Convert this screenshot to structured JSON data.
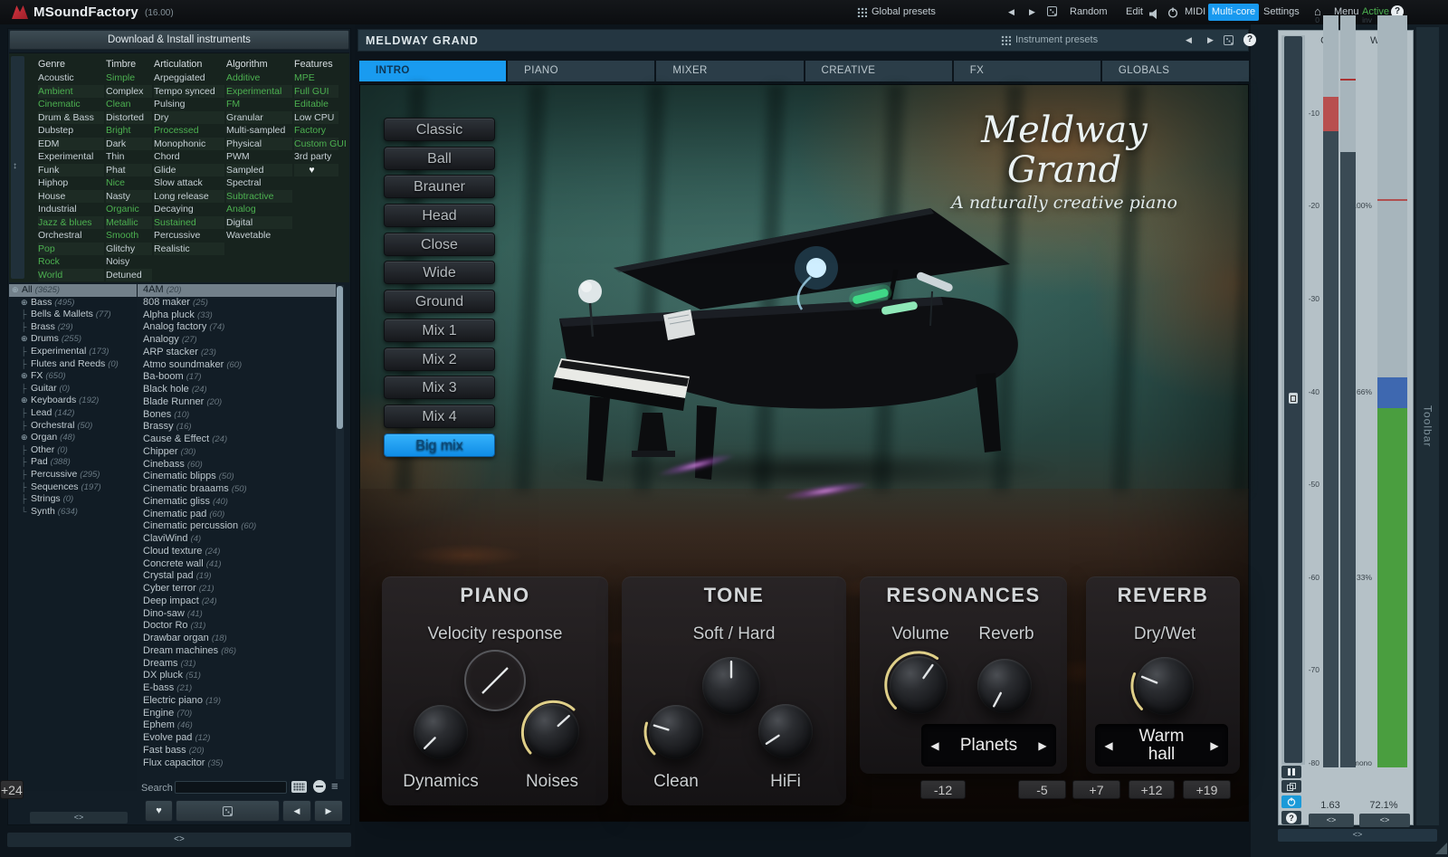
{
  "topbar": {
    "logo_text": "MSoundFactory",
    "version": "(16.00)",
    "global_presets": "Global presets",
    "random": "Random",
    "edit": "Edit",
    "midi": "MIDI",
    "multicore": "Multi-core",
    "settings": "Settings",
    "menu": "Menu",
    "active": "Active",
    "help": "?"
  },
  "browser": {
    "install_button": "Download & Install instruments",
    "search_label": "Search",
    "filters": {
      "genre": {
        "header": "Genre",
        "items": [
          {
            "label": "Acoustic",
            "state": "off"
          },
          {
            "label": "Ambient",
            "state": "on"
          },
          {
            "label": "Cinematic",
            "state": "on"
          },
          {
            "label": "Drum & Bass",
            "state": "off"
          },
          {
            "label": "Dubstep",
            "state": "off"
          },
          {
            "label": "EDM",
            "state": "off"
          },
          {
            "label": "Experimental",
            "state": "off"
          },
          {
            "label": "Funk",
            "state": "off"
          },
          {
            "label": "Hiphop",
            "state": "off"
          },
          {
            "label": "House",
            "state": "off"
          },
          {
            "label": "Industrial",
            "state": "off"
          },
          {
            "label": "Jazz & blues",
            "state": "on"
          },
          {
            "label": "Orchestral",
            "state": "off"
          },
          {
            "label": "Pop",
            "state": "on"
          },
          {
            "label": "Rock",
            "state": "on"
          },
          {
            "label": "World",
            "state": "on"
          }
        ]
      },
      "timbre": {
        "header": "Timbre",
        "items": [
          {
            "label": "Simple",
            "state": "on"
          },
          {
            "label": "Complex",
            "state": "off"
          },
          {
            "label": "Clean",
            "state": "on"
          },
          {
            "label": "Distorted",
            "state": "off"
          },
          {
            "label": "Bright",
            "state": "on"
          },
          {
            "label": "Dark",
            "state": "off"
          },
          {
            "label": "Thin",
            "state": "off"
          },
          {
            "label": "Phat",
            "state": "off"
          },
          {
            "label": "Nice",
            "state": "on"
          },
          {
            "label": "Nasty",
            "state": "off"
          },
          {
            "label": "Organic",
            "state": "on"
          },
          {
            "label": "Metallic",
            "state": "on"
          },
          {
            "label": "Smooth",
            "state": "on"
          },
          {
            "label": "Glitchy",
            "state": "off"
          },
          {
            "label": "Noisy",
            "state": "off"
          },
          {
            "label": "Detuned",
            "state": "off"
          }
        ]
      },
      "articulation": {
        "header": "Articulation",
        "items": [
          {
            "label": "Arpeggiated",
            "state": "off"
          },
          {
            "label": "Tempo synced",
            "state": "off"
          },
          {
            "label": "Pulsing",
            "state": "off"
          },
          {
            "label": "Dry",
            "state": "off"
          },
          {
            "label": "Processed",
            "state": "on"
          },
          {
            "label": "Monophonic",
            "state": "off"
          },
          {
            "label": "Chord",
            "state": "off"
          },
          {
            "label": "Glide",
            "state": "off"
          },
          {
            "label": "Slow attack",
            "state": "off"
          },
          {
            "label": "Long release",
            "state": "off"
          },
          {
            "label": "Decaying",
            "state": "off"
          },
          {
            "label": "Sustained",
            "state": "on"
          },
          {
            "label": "Percussive",
            "state": "off"
          },
          {
            "label": "Realistic",
            "state": "off"
          }
        ]
      },
      "algorithm": {
        "header": "Algorithm",
        "items": [
          {
            "label": "Additive",
            "state": "on"
          },
          {
            "label": "Experimental",
            "state": "on"
          },
          {
            "label": "FM",
            "state": "on"
          },
          {
            "label": "Granular",
            "state": "off"
          },
          {
            "label": "Multi-sampled",
            "state": "off"
          },
          {
            "label": "Physical",
            "state": "off"
          },
          {
            "label": "PWM",
            "state": "off"
          },
          {
            "label": "Sampled",
            "state": "off"
          },
          {
            "label": "Spectral",
            "state": "off"
          },
          {
            "label": "Subtractive",
            "state": "on"
          },
          {
            "label": "Analog",
            "state": "on"
          },
          {
            "label": "Digital",
            "state": "off"
          },
          {
            "label": "Wavetable",
            "state": "off"
          }
        ]
      },
      "features": {
        "header": "Features",
        "items": [
          {
            "label": "MPE",
            "state": "on"
          },
          {
            "label": "Full GUI",
            "state": "on"
          },
          {
            "label": "Editable",
            "state": "on"
          },
          {
            "label": "Low CPU",
            "state": "off"
          },
          {
            "label": "Factory",
            "state": "on"
          },
          {
            "label": "Custom GUI",
            "state": "on"
          },
          {
            "label": "3rd party",
            "state": "off"
          },
          {
            "label": "♥",
            "state": "fav"
          }
        ]
      }
    },
    "tree": {
      "items": [
        {
          "prefix": "expand",
          "label": "All",
          "count": "(3625)",
          "state": "selected",
          "indent": 0
        },
        {
          "prefix": "expand",
          "label": "Bass",
          "count": "(495)",
          "state": "off",
          "indent": 1
        },
        {
          "prefix": "tee",
          "label": "Bells & Mallets",
          "count": "(77)",
          "state": "off",
          "indent": 1
        },
        {
          "prefix": "tee",
          "label": "Brass",
          "count": "(29)",
          "state": "off",
          "indent": 1
        },
        {
          "prefix": "expand",
          "label": "Drums",
          "count": "(255)",
          "state": "off",
          "indent": 1
        },
        {
          "prefix": "tee",
          "label": "Experimental",
          "count": "(173)",
          "state": "off",
          "indent": 1
        },
        {
          "prefix": "tee",
          "label": "Flutes and Reeds",
          "count": "(0)",
          "state": "off",
          "indent": 1
        },
        {
          "prefix": "expand",
          "label": "FX",
          "count": "(650)",
          "state": "off",
          "indent": 1
        },
        {
          "prefix": "tee",
          "label": "Guitar",
          "count": "(0)",
          "state": "off",
          "indent": 1
        },
        {
          "prefix": "expand",
          "label": "Keyboards",
          "count": "(192)",
          "state": "off",
          "indent": 1
        },
        {
          "prefix": "tee",
          "label": "Lead",
          "count": "(142)",
          "state": "off",
          "indent": 1
        },
        {
          "prefix": "tee",
          "label": "Orchestral",
          "count": "(50)",
          "state": "off",
          "indent": 1
        },
        {
          "prefix": "expand",
          "label": "Organ",
          "count": "(48)",
          "state": "off",
          "indent": 1
        },
        {
          "prefix": "tee",
          "label": "Other",
          "count": "(0)",
          "state": "off",
          "indent": 1
        },
        {
          "prefix": "tee",
          "label": "Pad",
          "count": "(388)",
          "state": "off",
          "indent": 1
        },
        {
          "prefix": "tee",
          "label": "Percussive",
          "count": "(295)",
          "state": "off",
          "indent": 1
        },
        {
          "prefix": "tee",
          "label": "Sequences",
          "count": "(197)",
          "state": "off",
          "indent": 1
        },
        {
          "prefix": "tee",
          "label": "Strings",
          "count": "(0)",
          "state": "off",
          "indent": 1
        },
        {
          "prefix": "end",
          "label": "Synth",
          "count": "(634)",
          "state": "off",
          "indent": 1
        }
      ]
    },
    "instruments": {
      "items": [
        {
          "label": "4AM",
          "count": "(20)",
          "state": "selected"
        },
        {
          "label": "808 maker",
          "count": "(25)",
          "state": "off"
        },
        {
          "label": "Alpha pluck",
          "count": "(33)",
          "state": "off"
        },
        {
          "label": "Analog factory",
          "count": "(74)",
          "state": "off"
        },
        {
          "label": "Analogy",
          "count": "(27)",
          "state": "off"
        },
        {
          "label": "ARP stacker",
          "count": "(23)",
          "state": "off"
        },
        {
          "label": "Atmo soundmaker",
          "count": "(60)",
          "state": "off"
        },
        {
          "label": "Ba-boom",
          "count": "(17)",
          "state": "off"
        },
        {
          "label": "Black hole",
          "count": "(24)",
          "state": "off"
        },
        {
          "label": "Blade Runner",
          "count": "(20)",
          "state": "off"
        },
        {
          "label": "Bones",
          "count": "(10)",
          "state": "off"
        },
        {
          "label": "Brassy",
          "count": "(16)",
          "state": "off"
        },
        {
          "label": "Cause & Effect",
          "count": "(24)",
          "state": "off"
        },
        {
          "label": "Chipper",
          "count": "(30)",
          "state": "off"
        },
        {
          "label": "Cinebass",
          "count": "(60)",
          "state": "off"
        },
        {
          "label": "Cinematic blipps",
          "count": "(50)",
          "state": "off"
        },
        {
          "label": "Cinematic braaams",
          "count": "(50)",
          "state": "off"
        },
        {
          "label": "Cinematic gliss",
          "count": "(40)",
          "state": "off"
        },
        {
          "label": "Cinematic pad",
          "count": "(60)",
          "state": "off"
        },
        {
          "label": "Cinematic percussion",
          "count": "(60)",
          "state": "off"
        },
        {
          "label": "ClaviWind",
          "count": "(4)",
          "state": "off"
        },
        {
          "label": "Cloud texture",
          "count": "(24)",
          "state": "off"
        },
        {
          "label": "Concrete wall",
          "count": "(41)",
          "state": "off"
        },
        {
          "label": "Crystal pad",
          "count": "(19)",
          "state": "off"
        },
        {
          "label": "Cyber terror",
          "count": "(21)",
          "state": "off"
        },
        {
          "label": "Deep impact",
          "count": "(24)",
          "state": "off"
        },
        {
          "label": "Dino-saw",
          "count": "(41)",
          "state": "off"
        },
        {
          "label": "Doctor Ro",
          "count": "(31)",
          "state": "off"
        },
        {
          "label": "Drawbar organ",
          "count": "(18)",
          "state": "off"
        },
        {
          "label": "Dream machines",
          "count": "(86)",
          "state": "off"
        },
        {
          "label": "Dreams",
          "count": "(31)",
          "state": "off"
        },
        {
          "label": "DX pluck",
          "count": "(51)",
          "state": "off"
        },
        {
          "label": "E-bass",
          "count": "(21)",
          "state": "off"
        },
        {
          "label": "Electric piano",
          "count": "(19)",
          "state": "off"
        },
        {
          "label": "Engine",
          "count": "(70)",
          "state": "off"
        },
        {
          "label": "Ephem",
          "count": "(46)",
          "state": "off"
        },
        {
          "label": "Evolve pad",
          "count": "(12)",
          "state": "off"
        },
        {
          "label": "Fast bass",
          "count": "(20)",
          "state": "off"
        },
        {
          "label": "Flux capacitor",
          "count": "(35)",
          "state": "off"
        }
      ]
    }
  },
  "instrument": {
    "title": "MELDWAY GRAND",
    "presets_label": "Instrument presets",
    "tabs": [
      {
        "label": "INTRO",
        "state": "on"
      },
      {
        "label": "PIANO",
        "state": "off"
      },
      {
        "label": "MIXER",
        "state": "off"
      },
      {
        "label": "CREATIVE",
        "state": "off"
      },
      {
        "label": "FX",
        "state": "off"
      },
      {
        "label": "GLOBALS",
        "state": "off"
      }
    ],
    "hero": {
      "title": "Meldway Grand",
      "subtitle": "A naturally creative piano"
    },
    "mic_buttons": [
      {
        "label": "Classic",
        "state": "off"
      },
      {
        "label": "Ball",
        "state": "off"
      },
      {
        "label": "Brauner",
        "state": "off"
      },
      {
        "label": "Head",
        "state": "off"
      },
      {
        "label": "Close",
        "state": "off"
      },
      {
        "label": "Wide",
        "state": "off"
      },
      {
        "label": "Ground",
        "state": "off"
      },
      {
        "label": "Mix 1",
        "state": "off"
      },
      {
        "label": "Mix 2",
        "state": "off"
      },
      {
        "label": "Mix 3",
        "state": "off"
      },
      {
        "label": "Mix 4",
        "state": "off"
      },
      {
        "label": "Big mix",
        "state": "on"
      }
    ],
    "panels": {
      "piano": {
        "title": "PIANO",
        "control": "Velocity response",
        "knob1": "Dynamics",
        "knob2": "Noises"
      },
      "tone": {
        "title": "TONE",
        "control": "Soft / Hard",
        "knob1": "Clean",
        "knob2": "HiFi"
      },
      "resonances": {
        "title": "RESONANCES",
        "knob1": "Volume",
        "knob2": "Reverb",
        "selector": "Planets"
      },
      "reverb": {
        "title": "REVERB",
        "knob1": "Dry/Wet",
        "selector": "Warm hall"
      }
    },
    "transpose": [
      {
        "label": "-12"
      },
      {
        "label": "-5"
      },
      {
        "label": "+7"
      },
      {
        "label": "+12"
      },
      {
        "label": "+19"
      },
      {
        "label": "+24"
      }
    ]
  },
  "meters": {
    "out_label": "Out",
    "out_scale": [
      {
        "label": "0"
      },
      {
        "label": "-10"
      },
      {
        "label": "-20"
      },
      {
        "label": "-30"
      },
      {
        "label": "-40"
      },
      {
        "label": "-50"
      },
      {
        "label": "-60"
      },
      {
        "label": "-70"
      },
      {
        "label": "-80"
      }
    ],
    "width_label": "Width",
    "width_scale": [
      {
        "label": "inv"
      },
      {
        "label": "100%"
      },
      {
        "label": "66%"
      },
      {
        "label": "33%"
      },
      {
        "label": "mono"
      }
    ],
    "out_value": "1.63",
    "width_value": "72.1%",
    "toolbar_label": "Toolbar"
  },
  "colors": {
    "accent_blue": "#199bf0",
    "filter_green": "#4cb050",
    "knob_arc": "#ead98e",
    "meter_green": "#4a9e3f",
    "meter_blue": "#3e68b0",
    "meter_red": "#b84f4f"
  }
}
